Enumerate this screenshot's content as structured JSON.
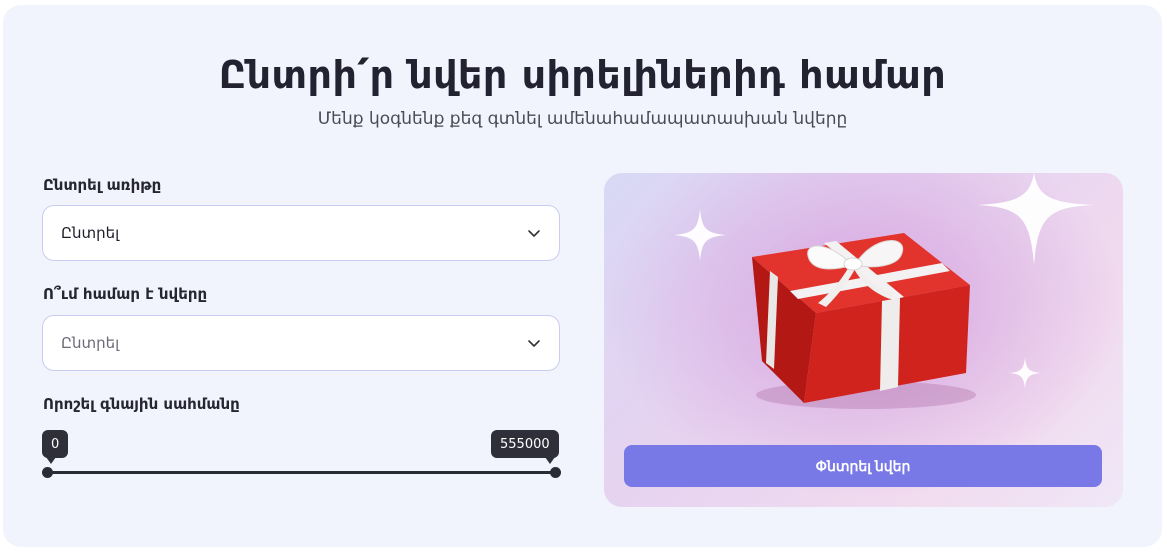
{
  "header": {
    "title": "Ընտրի՛ր նվեր սիրելիներիդ համար",
    "subtitle": "Մենք կօգնենք քեզ գտնել ամենահամապատասխան նվերը"
  },
  "form": {
    "occasion": {
      "label": "Ընտրել առիթը",
      "value": "Ընտրել"
    },
    "recipient": {
      "label": "Ո՞ւմ համար է նվերը",
      "value": "Ընտրել"
    },
    "price": {
      "label": "Որոշել գնային սահմանը",
      "min": "0",
      "max": "555000"
    }
  },
  "promo": {
    "button_label": "Փնտրել նվեր",
    "image": "gift-box-with-sparkles"
  },
  "colors": {
    "accent": "#7878e6",
    "card_bg": "#f1f3fd",
    "gift_red": "#d0211c",
    "ribbon": "#f4f4f4"
  },
  "icons": {
    "dropdown": "chevron-down-icon",
    "sparkle": "sparkle-icon"
  }
}
